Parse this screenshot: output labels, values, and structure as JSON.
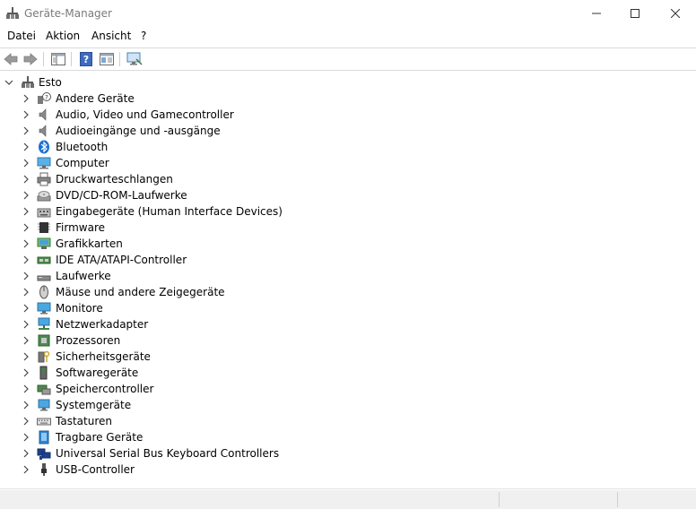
{
  "window": {
    "title": "Geräte-Manager"
  },
  "menu": {
    "file": "Datei",
    "action": "Aktion",
    "view": "Ansicht",
    "help": "?"
  },
  "tree": {
    "root": "Esto",
    "items": [
      {
        "label": "Andere Geräte",
        "icon": "unknown-device-icon"
      },
      {
        "label": "Audio, Video und Gamecontroller",
        "icon": "speaker-icon"
      },
      {
        "label": "Audioeingänge und -ausgänge",
        "icon": "speaker-icon"
      },
      {
        "label": "Bluetooth",
        "icon": "bluetooth-icon"
      },
      {
        "label": "Computer",
        "icon": "computer-icon"
      },
      {
        "label": "Druckwarteschlangen",
        "icon": "printer-icon"
      },
      {
        "label": "DVD/CD-ROM-Laufwerke",
        "icon": "disc-drive-icon"
      },
      {
        "label": "Eingabegeräte (Human Interface Devices)",
        "icon": "hid-icon"
      },
      {
        "label": "Firmware",
        "icon": "chip-icon"
      },
      {
        "label": "Grafikkarten",
        "icon": "display-adapter-icon"
      },
      {
        "label": "IDE ATA/ATAPI-Controller",
        "icon": "ide-controller-icon"
      },
      {
        "label": "Laufwerke",
        "icon": "disk-drive-icon"
      },
      {
        "label": "Mäuse und andere Zeigegeräte",
        "icon": "mouse-icon"
      },
      {
        "label": "Monitore",
        "icon": "monitor-icon"
      },
      {
        "label": "Netzwerkadapter",
        "icon": "network-adapter-icon"
      },
      {
        "label": "Prozessoren",
        "icon": "processor-icon"
      },
      {
        "label": "Sicherheitsgeräte",
        "icon": "security-device-icon"
      },
      {
        "label": "Softwaregeräte",
        "icon": "software-device-icon"
      },
      {
        "label": "Speichercontroller",
        "icon": "storage-controller-icon"
      },
      {
        "label": "Systemgeräte",
        "icon": "system-device-icon"
      },
      {
        "label": "Tastaturen",
        "icon": "keyboard-icon"
      },
      {
        "label": "Tragbare Geräte",
        "icon": "portable-device-icon"
      },
      {
        "label": "Universal Serial Bus Keyboard Controllers",
        "icon": "usb-keyboard-controller-icon"
      },
      {
        "label": "USB-Controller",
        "icon": "usb-icon"
      }
    ]
  }
}
